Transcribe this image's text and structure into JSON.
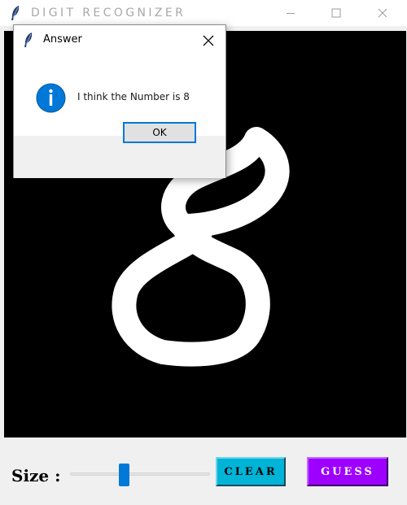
{
  "window": {
    "title": "DIGIT RECOGNIZER",
    "app_icon": "feather-icon",
    "controls": [
      "minimize-icon",
      "maximize-icon",
      "close-icon"
    ]
  },
  "canvas": {
    "background": "#000000",
    "drawing_color": "#ffffff",
    "drawn_content": "8"
  },
  "controls": {
    "size_label": "Size :",
    "size_slider_fraction": 0.38,
    "clear_label": "CLEAR",
    "guess_label": "GUESS",
    "clear_color": "#00b4d8",
    "guess_color": "#9d00ff"
  },
  "dialog": {
    "title": "Answer",
    "icon": "info-icon",
    "message": "I think the Number is 8",
    "ok_label": "OK",
    "accent": "#0078d7"
  }
}
